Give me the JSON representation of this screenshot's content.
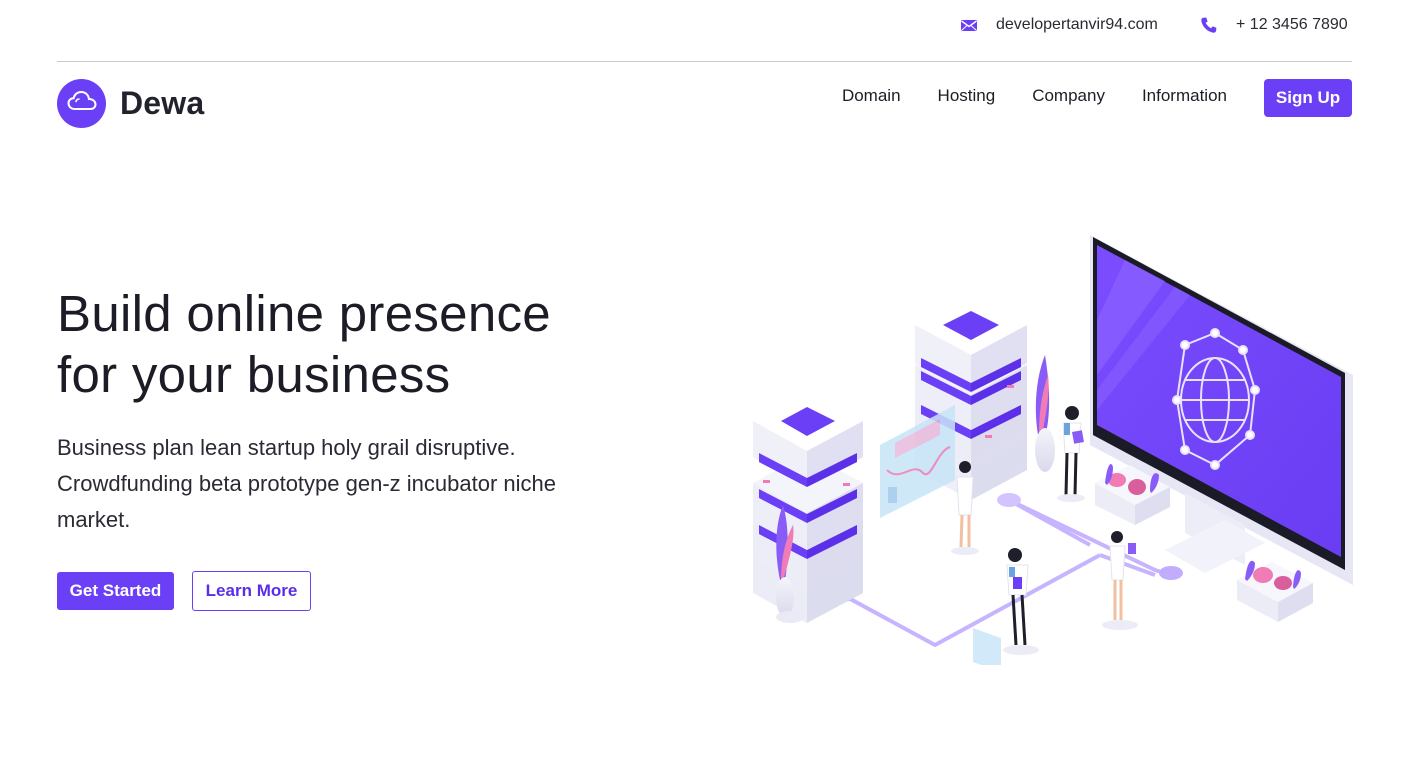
{
  "topbar": {
    "email": "developertanvir94.com",
    "phone": "+ 12 3456 7890",
    "email_icon": "mail-icon",
    "phone_icon": "phone-icon"
  },
  "brand": {
    "name": "Dewa",
    "icon": "cloud-icon",
    "accent": "#6b3ff5"
  },
  "nav": {
    "items": [
      {
        "label": "Domain"
      },
      {
        "label": "Hosting"
      },
      {
        "label": "Company"
      },
      {
        "label": "Information"
      }
    ],
    "signup_label": "Sign Up"
  },
  "hero": {
    "title_line1": "Build online presence",
    "title_line2": "for your business",
    "description": "Business plan lean startup holy grail disruptive. Crowdfunding beta prototype gen-z incubator niche market.",
    "primary_cta": "Get Started",
    "secondary_cta": "Learn More"
  },
  "illustration": {
    "name": "isometric-hosting-illustration"
  }
}
